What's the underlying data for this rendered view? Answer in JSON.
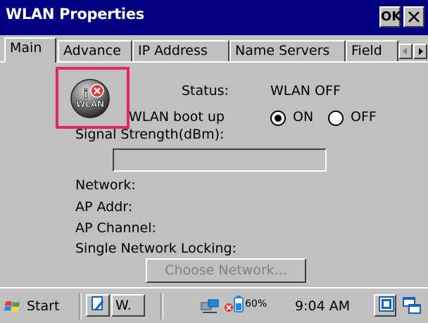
{
  "window": {
    "title": "WLAN Properties",
    "ok_label": "OK"
  },
  "tabs": [
    {
      "label": "Main"
    },
    {
      "label": "Advance"
    },
    {
      "label": "IP Address"
    },
    {
      "label": "Name Servers"
    },
    {
      "label": "Field"
    }
  ],
  "main": {
    "icon_label": "WLAN",
    "status_label": "Status:",
    "status_value": "WLAN OFF",
    "boot_label": "WLAN boot up",
    "boot_options": [
      {
        "label": "ON",
        "selected": true
      },
      {
        "label": "OFF",
        "selected": false
      }
    ],
    "signal_label": "Signal Strength(dBm):",
    "signal_value": "",
    "network_label": "Network:",
    "ap_addr_label": "AP Addr:",
    "ap_channel_label": "AP Channel:",
    "locking_label": "Single Network Locking:",
    "choose_button_label": "Choose Network..."
  },
  "taskbar": {
    "start_label": "Start",
    "task_label": "W.",
    "battery_percent": "60%",
    "clock": "9:04 AM"
  },
  "colors": {
    "titlebar": "#000080",
    "face": "#c0c0c0",
    "highlight_box": "#e2246e",
    "error_red": "#e53935"
  },
  "icons": [
    "close-icon",
    "arrow-left-icon",
    "arrow-right-icon",
    "wlan-icon",
    "windows-logo-icon",
    "tablet-icon",
    "network-icon",
    "battery-icon",
    "input-panel-icon",
    "window-switch-icon"
  ]
}
